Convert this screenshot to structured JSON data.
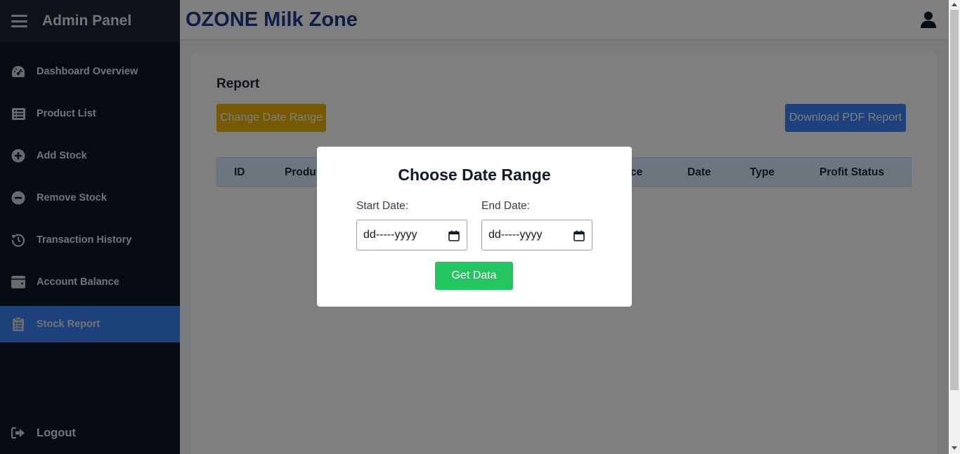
{
  "sidebar": {
    "title": "Admin Panel",
    "items": [
      {
        "label": "Dashboard Overview",
        "icon": "gauge-icon"
      },
      {
        "label": "Product List",
        "icon": "list-icon"
      },
      {
        "label": "Add Stock",
        "icon": "plus-circle-icon"
      },
      {
        "label": "Remove Stock",
        "icon": "minus-circle-icon"
      },
      {
        "label": "Transaction History",
        "icon": "history-icon"
      },
      {
        "label": "Account Balance",
        "icon": "wallet-icon"
      },
      {
        "label": "Stock Report",
        "icon": "clipboard-icon",
        "active": true
      }
    ],
    "logout_label": "Logout"
  },
  "header": {
    "title": "OZONE Milk Zone"
  },
  "main": {
    "title": "Report",
    "change_range_label": "Change Date Range",
    "download_label": "Download PDF Report",
    "table_headers": [
      "ID",
      "Produ",
      "ce",
      "Date",
      "Type",
      "Profit Status"
    ]
  },
  "modal": {
    "title": "Choose Date Range",
    "start_label": "Start Date:",
    "end_label": "End Date:",
    "start_value": "dd-----yyyy",
    "end_value": "dd-----yyyy",
    "submit_label": "Get Data"
  },
  "colors": {
    "sidebar_bg": "#0f172a",
    "active_item": "#3b82f6",
    "title_color": "#1e3a8a",
    "change_button": "#eab308",
    "download_button": "#3b82f6",
    "get_data_button": "#22c55e"
  }
}
